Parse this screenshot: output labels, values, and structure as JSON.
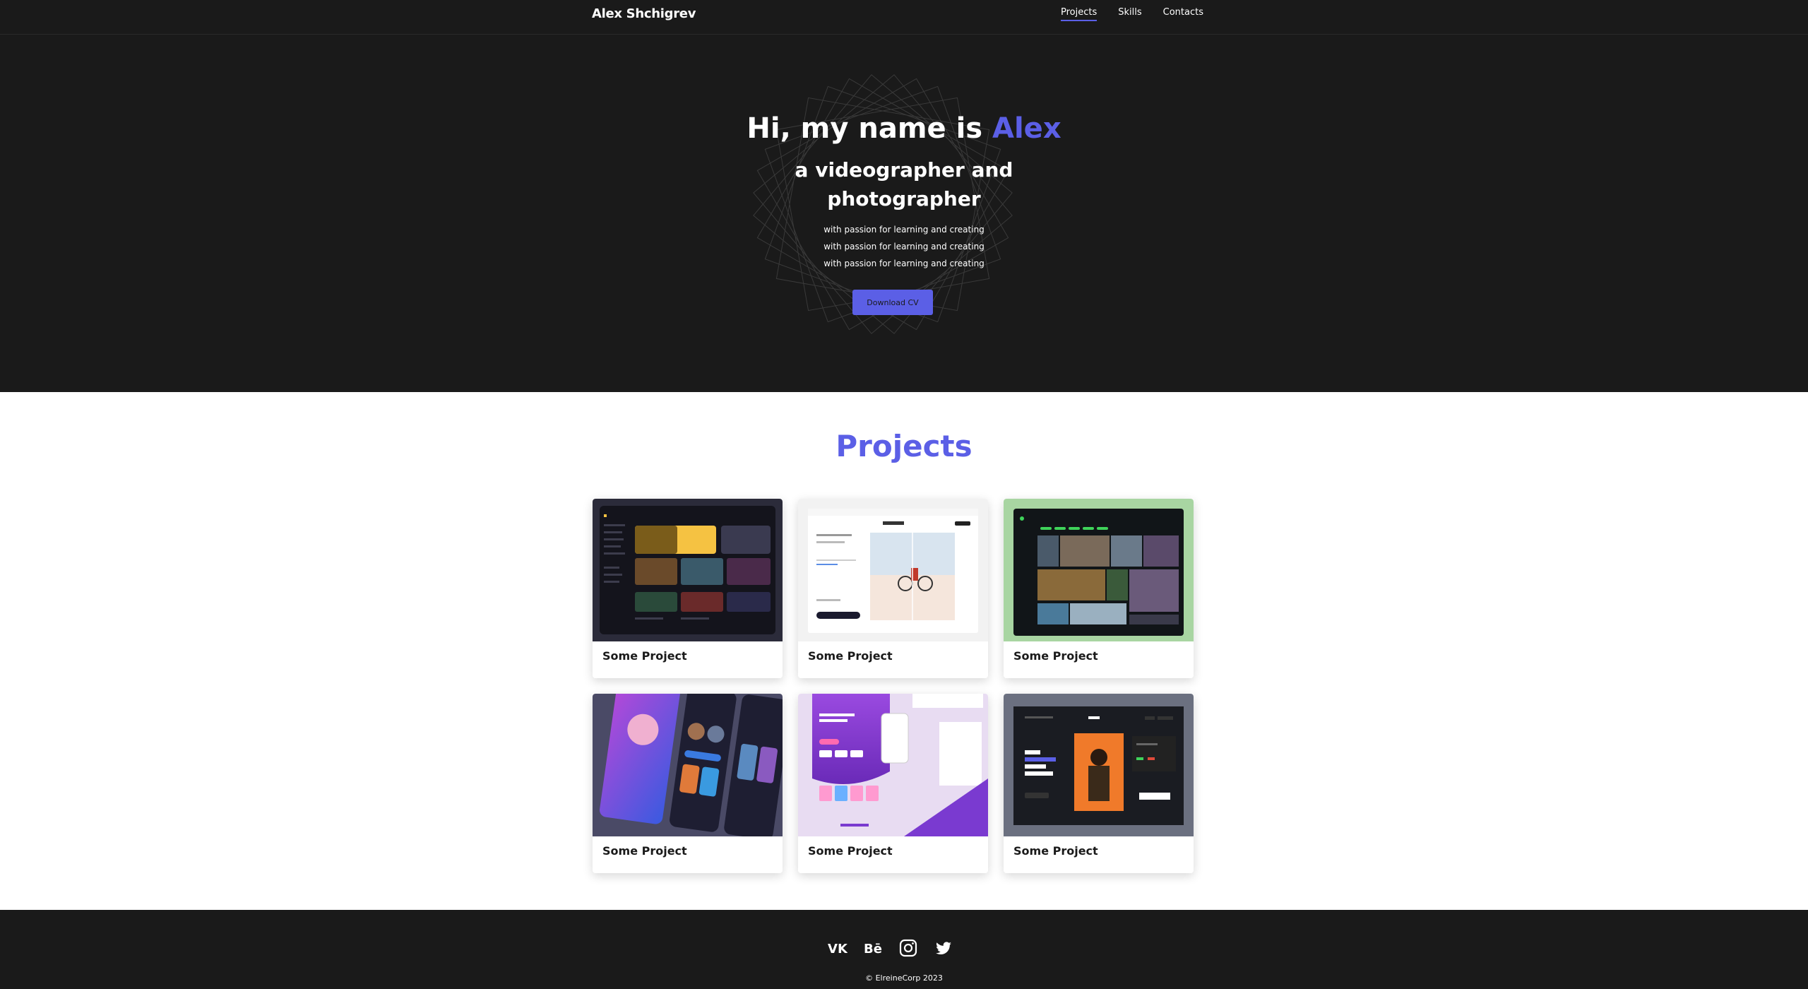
{
  "header": {
    "logo": "Alex Shchigrev",
    "nav": [
      {
        "label": "Projects",
        "active": true
      },
      {
        "label": "Skills",
        "active": false
      },
      {
        "label": "Contacts",
        "active": false
      }
    ]
  },
  "hero": {
    "greeting": "Hi, my name is ",
    "name": "Alex",
    "subtitle_line1": "a videographer and",
    "subtitle_line2": "photographer",
    "tagline_lines": [
      "with passion for learning and creating",
      "with passion for learning and creating",
      "with passion for learning and creating"
    ],
    "cv_button": "Download CV"
  },
  "projects": {
    "title": "Projects",
    "cards": [
      {
        "label": "Some Project",
        "thumb_bg": "#2b2b3a",
        "thumb_icon": "gaming-dashboard-thumbnail"
      },
      {
        "label": "Some Project",
        "thumb_bg": "#f2f2f2",
        "thumb_icon": "photo-editor-thumbnail"
      },
      {
        "label": "Some Project",
        "thumb_bg": "#a8d5a2",
        "thumb_icon": "video-library-thumbnail"
      },
      {
        "label": "Some Project",
        "thumb_bg": "#4a4a66",
        "thumb_icon": "streaming-mobile-app-thumbnail"
      },
      {
        "label": "Some Project",
        "thumb_bg": "#e8dcf2",
        "thumb_icon": "purple-landing-page-thumbnail"
      },
      {
        "label": "Some Project",
        "thumb_bg": "#6b7080",
        "thumb_icon": "streaming-games-landing-thumbnail"
      }
    ]
  },
  "footer": {
    "socials": [
      "vk-icon",
      "behance-icon",
      "instagram-icon",
      "twitter-icon"
    ],
    "copyright": "© ElreineCorp 2023"
  },
  "colors": {
    "accent": "#5b5fe6",
    "dark_bg": "#1a1a1a",
    "light_bg": "#ffffff"
  }
}
